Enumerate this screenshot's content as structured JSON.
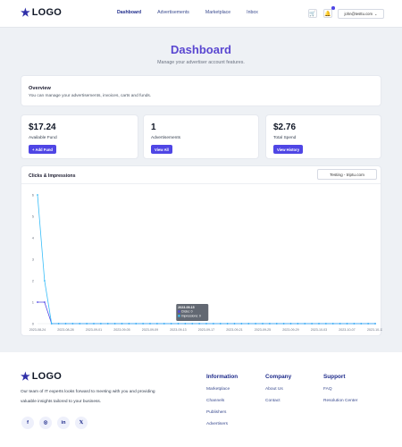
{
  "header": {
    "logo_text": "LOGO",
    "nav": [
      "Dashboard",
      "Advertisements",
      "Marketplace",
      "Inbox"
    ],
    "active_nav": "Dashboard",
    "cart_icon": "cart-icon",
    "bell_icon": "bell-icon",
    "user_email": "john@testtu.com",
    "user_chevron": "⌄"
  },
  "page": {
    "title": "Dashboard",
    "subtitle": "Manage your advertiser account features."
  },
  "overview": {
    "title": "Overview",
    "text": "You can manage your advertisements, invoices, carts and funds."
  },
  "stats": [
    {
      "value": "$17.24",
      "label": "Available Fund",
      "button": "+ Add Fund"
    },
    {
      "value": "1",
      "label": "Advertisements",
      "button": "View All"
    },
    {
      "value": "$2.76",
      "label": "Total Spend",
      "button": "View History"
    }
  ],
  "chart_section": {
    "title": "Clicks & Impressions",
    "select_value": "Testing - triptu.com"
  },
  "chart_data": {
    "type": "line",
    "title": "Clicks & Impressions",
    "x_ticks": [
      "2023-08-24",
      "2023-08-28",
      "2023-09-01",
      "2023-09-05",
      "2023-09-09",
      "2023-09-13",
      "2023-09-17",
      "2023-09-21",
      "2023-09-25",
      "2023-09-29",
      "2023-10-03",
      "2023-10-07",
      "2023-10-11"
    ],
    "y_ticks": [
      "0",
      "1",
      "2",
      "3",
      "4",
      "5",
      "6"
    ],
    "ylim": [
      0,
      6
    ],
    "x": [
      "2023-08-24",
      "2023-08-25",
      "2023-08-26",
      "2023-08-27",
      "2023-08-28",
      "2023-08-29",
      "2023-08-30",
      "2023-08-31",
      "2023-09-01",
      "2023-09-02",
      "2023-09-03",
      "2023-09-04",
      "2023-09-05",
      "2023-09-06",
      "2023-09-07",
      "2023-09-08",
      "2023-09-09",
      "2023-09-10",
      "2023-09-11",
      "2023-09-12",
      "2023-09-13",
      "2023-09-14",
      "2023-09-15",
      "2023-09-16",
      "2023-09-17",
      "2023-09-18",
      "2023-09-19",
      "2023-09-20",
      "2023-09-21",
      "2023-09-22",
      "2023-09-23",
      "2023-09-24",
      "2023-09-25",
      "2023-09-26",
      "2023-09-27",
      "2023-09-28",
      "2023-09-29",
      "2023-09-30",
      "2023-10-01",
      "2023-10-02",
      "2023-10-03",
      "2023-10-04",
      "2023-10-05",
      "2023-10-06",
      "2023-10-07",
      "2023-10-08",
      "2023-10-09",
      "2023-10-10",
      "2023-10-11"
    ],
    "series": [
      {
        "name": "Clicks",
        "color": "#4f46e5",
        "values": [
          1,
          1,
          0,
          0,
          0,
          0,
          0,
          0,
          0,
          0,
          0,
          0,
          0,
          0,
          0,
          0,
          0,
          0,
          0,
          0,
          0,
          0,
          0,
          0,
          0,
          0,
          0,
          0,
          0,
          0,
          0,
          0,
          0,
          0,
          0,
          0,
          0,
          0,
          0,
          0,
          0,
          0,
          0,
          0,
          0,
          0,
          0,
          0,
          0
        ]
      },
      {
        "name": "Impressions",
        "color": "#38bdf8",
        "values": [
          6,
          2,
          0,
          0,
          0,
          0,
          0,
          0,
          0,
          0,
          0,
          0,
          0,
          0,
          0,
          0,
          0,
          0,
          0,
          0,
          0,
          0,
          0,
          0,
          0,
          0,
          0,
          0,
          0,
          0,
          0,
          0,
          0,
          0,
          0,
          0,
          0,
          0,
          0,
          0,
          0,
          0,
          0,
          0,
          0,
          0,
          0,
          0,
          0
        ]
      }
    ],
    "tooltip": {
      "date": "2023-09-15",
      "lines": [
        "Clicks: 0",
        "Impressions: 0"
      ]
    },
    "grid": false
  },
  "footer": {
    "logo_text": "LOGO",
    "description": "Our team of IT experts looks forward to meeting with you and providing valuable insights tailored to your business.",
    "social": [
      "f",
      "◎",
      "in",
      "𝕏"
    ],
    "social_names": [
      "facebook-icon",
      "instagram-icon",
      "linkedin-icon",
      "x-icon"
    ],
    "columns": [
      {
        "title": "Information",
        "links": [
          "Marketplace",
          "Channels",
          "Publishers",
          "Advertisers"
        ]
      },
      {
        "title": "Company",
        "links": [
          "About Us",
          "Contact"
        ]
      },
      {
        "title": "Support",
        "links": [
          "FAQ",
          "Resolution Center"
        ]
      }
    ]
  }
}
